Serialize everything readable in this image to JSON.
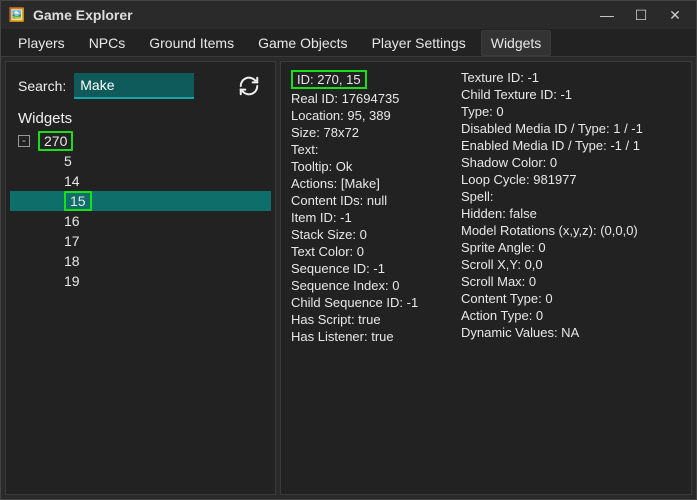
{
  "window": {
    "title": "Game Explorer",
    "iconEmoji": "🖼️"
  },
  "tabs": [
    {
      "label": "Players"
    },
    {
      "label": "NPCs"
    },
    {
      "label": "Ground Items"
    },
    {
      "label": "Game Objects"
    },
    {
      "label": "Player Settings"
    },
    {
      "label": "Widgets",
      "active": true
    }
  ],
  "sidebar": {
    "searchLabel": "Search:",
    "searchValue": "Make",
    "treeHeader": "Widgets",
    "rootNode": "270",
    "children": [
      "5",
      "14",
      "15",
      "16",
      "17",
      "18",
      "19"
    ],
    "selected": "15"
  },
  "details": {
    "col1": [
      {
        "text": "ID: 270, 15",
        "hl": true
      },
      {
        "text": "Real ID: 17694735"
      },
      {
        "text": "Location: 95, 389"
      },
      {
        "text": "Size: 78x72"
      },
      {
        "text": "Text:"
      },
      {
        "text": "Tooltip: Ok"
      },
      {
        "text": "Actions: [Make]"
      },
      {
        "text": "Content IDs: null"
      },
      {
        "text": "Item ID: -1"
      },
      {
        "text": "Stack Size: 0"
      },
      {
        "text": "Text Color: 0"
      },
      {
        "text": "Sequence ID: -1"
      },
      {
        "text": "Sequence Index: 0"
      },
      {
        "text": "Child Sequence ID: -1"
      },
      {
        "text": "Has Script: true"
      },
      {
        "text": "Has Listener: true"
      }
    ],
    "col2": [
      {
        "text": "Texture ID: -1"
      },
      {
        "text": "Child Texture ID: -1"
      },
      {
        "text": "Type: 0"
      },
      {
        "text": "Disabled Media ID / Type: 1 / -1"
      },
      {
        "text": "Enabled Media ID / Type: -1 / 1"
      },
      {
        "text": "Shadow Color: 0"
      },
      {
        "text": "Loop Cycle: 981977"
      },
      {
        "text": "Spell:"
      },
      {
        "text": "Hidden: false"
      },
      {
        "text": "Model Rotations (x,y,z): (0,0,0)"
      },
      {
        "text": "Sprite Angle: 0"
      },
      {
        "text": "Scroll X,Y: 0,0"
      },
      {
        "text": "Scroll Max: 0"
      },
      {
        "text": "Content Type: 0"
      },
      {
        "text": "Action Type: 0"
      },
      {
        "text": "Dynamic Values: NA"
      }
    ]
  }
}
